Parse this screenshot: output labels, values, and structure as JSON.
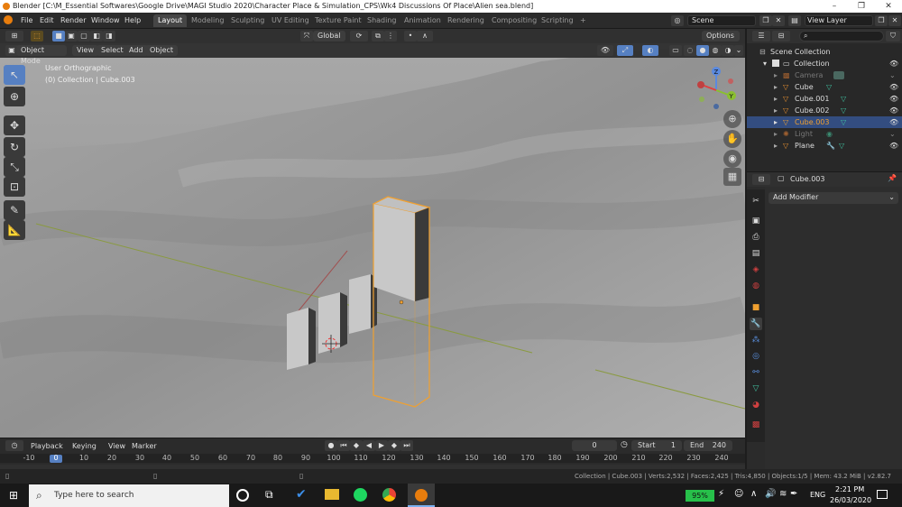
{
  "window": {
    "title": "Blender [C:\\M_Essential Softwares\\Google Drive\\MAGI Studio 2020\\Character Place & Simulation_CPS\\Wk4 Discussions Of Place\\Alien sea.blend]",
    "controls": [
      "–",
      "❐",
      "✕"
    ]
  },
  "menu": [
    "File",
    "Edit",
    "Render",
    "Window",
    "Help"
  ],
  "workspaces": [
    "Layout",
    "Modeling",
    "Sculpting",
    "UV Editing",
    "Texture Paint",
    "Shading",
    "Animation",
    "Rendering",
    "Compositing",
    "Scripting"
  ],
  "workspace_add": "+",
  "scene": {
    "label": "Scene",
    "view_layer": "View Layer"
  },
  "viewport_header": {
    "mode": "Object Mode",
    "view": "View",
    "select": "Select",
    "add": "Add",
    "object": "Object",
    "orientation": "Global",
    "options": "Options"
  },
  "viewport_overlay": {
    "view_name": "User Orthographic",
    "collection": "(0) Collection | Cube.003"
  },
  "gizmo": {
    "x": "X",
    "y": "Y",
    "z": "Z"
  },
  "outliner": {
    "search_placeholder": "",
    "scene_collection": "Scene Collection",
    "collection": "Collection",
    "items": [
      {
        "name": "Camera",
        "dim": true,
        "selected": false
      },
      {
        "name": "Cube",
        "dim": false,
        "selected": false
      },
      {
        "name": "Cube.001",
        "dim": false,
        "selected": false
      },
      {
        "name": "Cube.002",
        "dim": false,
        "selected": false
      },
      {
        "name": "Cube.003",
        "dim": false,
        "selected": true
      },
      {
        "name": "Light",
        "dim": true,
        "selected": false
      },
      {
        "name": "Plane",
        "dim": false,
        "selected": false
      }
    ]
  },
  "properties": {
    "object_name": "Cube.003",
    "add_modifier": "Add Modifier"
  },
  "timeline": {
    "playback": "Playback",
    "keying": "Keying",
    "view": "View",
    "marker": "Marker",
    "current_frame": "0",
    "start_label": "Start",
    "start": "1",
    "end_label": "End",
    "end": "240",
    "ruler": [
      "-10",
      "0",
      "10",
      "20",
      "30",
      "40",
      "50",
      "60",
      "70",
      "80",
      "90",
      "100",
      "110",
      "120",
      "130",
      "140",
      "150",
      "160",
      "170",
      "180",
      "190",
      "200",
      "210",
      "220",
      "230",
      "240"
    ]
  },
  "statusbar": {
    "text": "Collection | Cube.003 | Verts:2,532 | Faces:2,425 | Tris:4,850 | Objects:1/5 | Mem: 43.2 MiB | v2.82.7"
  },
  "taskbar": {
    "search_placeholder": "Type here to search",
    "battery": "95%",
    "language": "ENG",
    "time": "2:21 PM",
    "date": "26/03/2020"
  },
  "colors": {
    "accent": "#5680c2",
    "selection_outline": "#f0a030",
    "selected_row": "#334d80",
    "blender_orange": "#e87d0d"
  }
}
